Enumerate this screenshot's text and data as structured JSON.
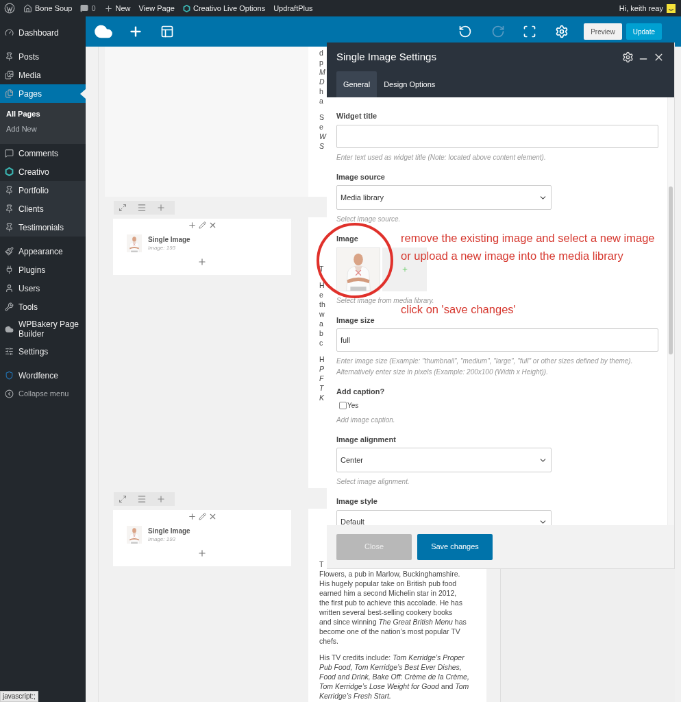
{
  "admin_bar": {
    "items": [
      {
        "label": "Bone Soup"
      },
      {
        "label": "0"
      },
      {
        "label": "New"
      },
      {
        "label": "View Page"
      },
      {
        "label": "Creativo Live Options"
      },
      {
        "label": "UpdraftPlus"
      }
    ],
    "greeting": "Hi, keith reay"
  },
  "sidebar": {
    "groups": [
      [
        {
          "label": "Dashboard",
          "selected": false,
          "shaded": false
        }
      ],
      [
        {
          "label": "Posts",
          "selected": false,
          "shaded": false
        },
        {
          "label": "Media",
          "selected": false,
          "shaded": false
        },
        {
          "label": "Pages",
          "selected": true,
          "shaded": false,
          "children": [
            {
              "label": "All Pages",
              "selected": true
            },
            {
              "label": "Add New",
              "selected": false
            }
          ]
        },
        {
          "label": "Comments",
          "selected": false,
          "shaded": false
        },
        {
          "label": "Creativo",
          "selected": false,
          "shaded": false
        },
        {
          "label": "Portfolio",
          "selected": false,
          "shaded": true
        },
        {
          "label": "Clients",
          "selected": false,
          "shaded": true
        },
        {
          "label": "Testimonials",
          "selected": false,
          "shaded": true
        }
      ],
      [
        {
          "label": "Appearance",
          "selected": false,
          "shaded": false
        },
        {
          "label": "Plugins",
          "selected": false,
          "shaded": false
        },
        {
          "label": "Users",
          "selected": false,
          "shaded": false
        },
        {
          "label": "Tools",
          "selected": false,
          "shaded": false
        },
        {
          "label": "WPBakery Page Builder",
          "selected": false,
          "shaded": false
        },
        {
          "label": "Settings",
          "selected": false,
          "shaded": false
        }
      ],
      [
        {
          "label": "Wordfence",
          "selected": false,
          "shaded": false
        }
      ]
    ],
    "collapse": "Collapse menu"
  },
  "toolbar": {
    "redo_disabled": true,
    "buttons": [
      {
        "label": "Preview",
        "kind": "secondary"
      },
      {
        "label": "Update",
        "kind": "primary"
      }
    ]
  },
  "editor": {
    "rows": [
      {
        "paragraphs": [
          [
            {
              "text": "d",
              "italic": false
            },
            {
              "text": "p",
              "italic": false
            },
            {
              "text": "M",
              "italic": true
            },
            {
              "text": "D",
              "italic": true
            },
            {
              "text": "h",
              "italic": false
            },
            {
              "text": "a",
              "italic": false
            }
          ],
          [
            {
              "text": "S",
              "italic": false
            },
            {
              "text": "e",
              "italic": false
            },
            {
              "text": "W",
              "italic": true
            },
            {
              "text": "S",
              "italic": true
            }
          ]
        ]
      },
      {
        "element": {
          "title": "Single Image",
          "subtitle": "Image: 193"
        },
        "paragraphs": [
          [
            {
              "text": "T",
              "italic": false
            }
          ],
          [
            {
              "text": "H",
              "italic": false
            },
            {
              "text": "e",
              "italic": false
            },
            {
              "text": "th",
              "italic": false
            },
            {
              "text": "w",
              "italic": false
            },
            {
              "text": "a",
              "italic": false
            },
            {
              "text": "b",
              "italic": false
            },
            {
              "text": "c",
              "italic": false
            }
          ],
          [
            {
              "text": "H",
              "italic": false
            },
            {
              "text": "P",
              "italic": true
            },
            {
              "text": "F",
              "italic": true
            },
            {
              "text": "T",
              "italic": true
            },
            {
              "text": "K",
              "italic": true
            }
          ]
        ]
      },
      {
        "element": {
          "title": "Single Image",
          "subtitle": "Image: 193"
        },
        "paragraphs": [
          [
            {
              "text": "T",
              "italic": false
            },
            {
              "text": "Flowers, a pub in Marlow, Buckinghamshire.",
              "italic": false
            },
            {
              "text": "His hugely popular take on British pub food",
              "italic": false
            },
            {
              "text": "earned him a second Michelin star in 2012,",
              "italic": false
            },
            {
              "text": "the first pub to achieve this accolade. He has",
              "italic": false
            },
            {
              "text": "written several best-selling cookery books",
              "italic": false
            },
            {
              "text": "and since winning *The Great British Menu* has",
              "italic": false
            },
            {
              "text": "become one of the nation’s most popular TV",
              "italic": false
            },
            {
              "text": "chefs.",
              "italic": false
            }
          ],
          [
            {
              "text": "His TV credits include: *Tom Kerridge’s Proper*",
              "italic": false
            },
            {
              "text": "Pub Food, Tom Kerridge’s Best Ever Dishes,",
              "italic": true
            },
            {
              "text": "Food and Drink, Bake Off: Crème de la Crème,",
              "italic": true
            },
            {
              "text": "*Tom Kerridge’s Lose Weight for Good* and *Tom*",
              "italic": false
            },
            {
              "text": "Kerridge’s Fresh Start.",
              "italic": true
            }
          ]
        ]
      }
    ]
  },
  "modal": {
    "title": "Single Image Settings",
    "tabs": [
      {
        "label": "General",
        "selected": true
      },
      {
        "label": "Design Options",
        "selected": false
      }
    ],
    "fields": [
      {
        "kind": "text",
        "label": "Widget title",
        "help": "Enter text used as widget title (Note: located above content element)."
      },
      {
        "kind": "select",
        "label": "Image source",
        "value": "Media library",
        "help": "Select image source."
      },
      {
        "label": "Image",
        "help": "Select image from media library."
      },
      {
        "kind": "text",
        "label": "Image size",
        "value": "full",
        "help": "Enter image size (Example: \"thumbnail\", \"medium\", \"large\", \"full\" or other sizes defined by theme). Alternatively enter size in pixels (Example: 200x100 (Width x Height))."
      },
      {
        "kind": "checkbox",
        "label": "Add caption?",
        "option": "Yes",
        "checked": false,
        "help": "Add image caption."
      },
      {
        "kind": "select",
        "label": "Image alignment",
        "value": "Center",
        "help": "Select image alignment."
      },
      {
        "kind": "select",
        "label": "Image style",
        "value": "Default"
      }
    ],
    "buttons": [
      {
        "label": "Close",
        "disabled": true
      },
      {
        "label": "Save changes",
        "disabled": false
      }
    ]
  },
  "annotations": [
    {
      "text": "remove the existing image and select a new image or upload a new image into the media library"
    },
    {
      "text": "click on 'save changes'"
    }
  ],
  "status_tip": "javascript:;"
}
